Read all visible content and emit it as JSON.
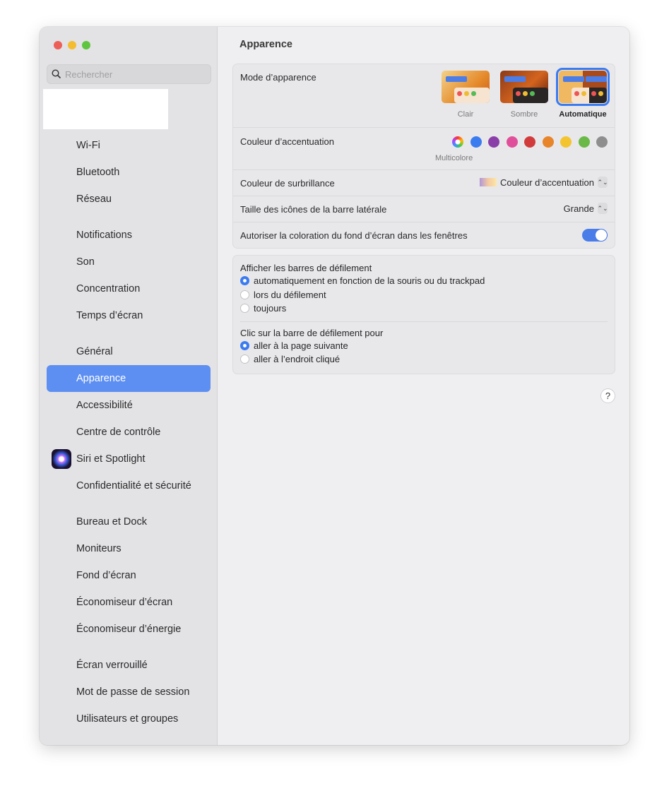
{
  "window": {
    "controls": {
      "close": "#ec5f57",
      "minimize": "#f4bd30",
      "zoom": "#5fc53f"
    }
  },
  "sidebar": {
    "search_placeholder": "Rechercher",
    "items": [
      {
        "label": "Wi-Fi",
        "gap": false
      },
      {
        "label": "Bluetooth"
      },
      {
        "label": "Réseau"
      },
      {
        "label": "Notifications",
        "gap": true
      },
      {
        "label": "Son"
      },
      {
        "label": "Concentration"
      },
      {
        "label": "Temps d’écran"
      },
      {
        "label": "Général",
        "gap": true
      },
      {
        "label": "Apparence",
        "selected": true
      },
      {
        "label": "Accessibilité"
      },
      {
        "label": "Centre de contrôle"
      },
      {
        "label": "Siri et Spotlight",
        "icon": "siri-icon"
      },
      {
        "label": "Confidentialité et sécurité"
      },
      {
        "label": "Bureau et Dock",
        "gap": true
      },
      {
        "label": "Moniteurs"
      },
      {
        "label": "Fond d’écran"
      },
      {
        "label": "Économiseur d’écran"
      },
      {
        "label": "Économiseur d’énergie"
      },
      {
        "label": "Écran verrouillé",
        "gap": true
      },
      {
        "label": "Mot de passe de session"
      },
      {
        "label": "Utilisateurs et groupes"
      }
    ]
  },
  "main": {
    "title": "Apparence",
    "appearance": {
      "label": "Mode d’apparence",
      "options": [
        "Clair",
        "Sombre",
        "Automatique"
      ],
      "selected": "Automatique"
    },
    "accent": {
      "label": "Couleur d’accentuation",
      "colors": [
        "multicolor",
        "#3b7bf0",
        "#8a3fa8",
        "#e0509a",
        "#d23b3b",
        "#e8842a",
        "#f4c430",
        "#6ab847",
        "#8e8e8e"
      ],
      "selected_label": "Multicolore"
    },
    "highlight": {
      "label": "Couleur de surbrillance",
      "value": "Couleur d’accentuation"
    },
    "sidebar_icon_size": {
      "label": "Taille des icônes de la barre latérale",
      "value": "Grande"
    },
    "wallpaper_tint": {
      "label": "Autoriser la coloration du fond d’écran dans les fenêtres",
      "on": true
    },
    "scrollbars": {
      "label": "Afficher les barres de défilement",
      "options": [
        "automatiquement en fonction de la souris ou du trackpad",
        "lors du défilement",
        "toujours"
      ],
      "selected": 0
    },
    "click": {
      "label": "Clic sur la barre de défilement pour",
      "options": [
        "aller à la page suivante",
        "aller à l’endroit cliqué"
      ],
      "selected": 0
    },
    "help": "?"
  }
}
